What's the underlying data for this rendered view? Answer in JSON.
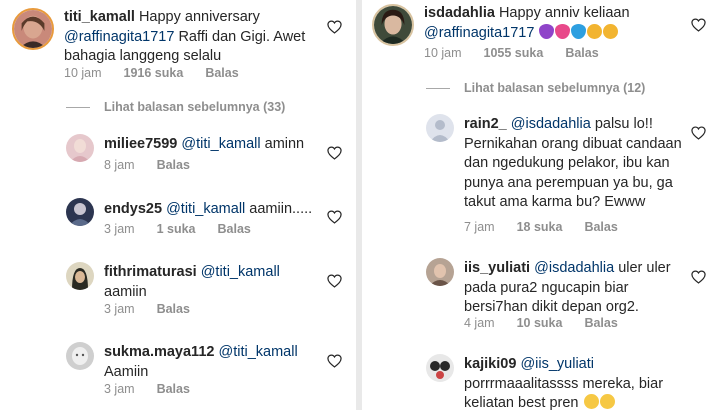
{
  "left": {
    "top_comment": {
      "username": "titi_kamall",
      "text_1": "Happy anniversary",
      "mention": "@raffinagita1717",
      "text_2": "Raffi dan Gigi. Awet bahagia langgeng selalu",
      "time": "10 jam",
      "likes": "1916 suka",
      "reply": "Balas"
    },
    "view_replies": "Lihat balasan sebelumnya (33)",
    "replies": [
      {
        "username": "miliee7599",
        "mention": "@titi_kamall",
        "text": "aminn",
        "time": "8 jam",
        "likes": "",
        "reply": "Balas"
      },
      {
        "username": "endys25",
        "mention": "@titi_kamall",
        "text": "aamiin.....",
        "time": "3 jam",
        "likes": "1 suka",
        "reply": "Balas"
      },
      {
        "username": "fithrimaturasi",
        "mention": "@titi_kamall",
        "text": "aamiin",
        "time": "3 jam",
        "likes": "",
        "reply": "Balas"
      },
      {
        "username": "sukma.maya112",
        "mention": "@titi_kamall",
        "text": "Aamiin",
        "time": "3 jam",
        "likes": "",
        "reply": "Balas"
      }
    ]
  },
  "right": {
    "top_comment": {
      "username": "isdadahlia",
      "text_1": "Happy anniv keliaan",
      "mention": "@raffinagita1717",
      "emojis": [
        "purple-heart",
        "pink-heart",
        "blue-heart",
        "folded-hands",
        "folded-hands"
      ],
      "time": "10 jam",
      "likes": "1055 suka",
      "reply": "Balas"
    },
    "view_replies": "Lihat balasan sebelumnya (12)",
    "replies": [
      {
        "username": "rain2_",
        "mention": "@isdadahlia",
        "text": "palsu lo!! Pernikahan orang dibuat candaan dan ngedukung pelakor, ibu kan punya ana perempuan ya bu, ga takut ama karma bu? Ewww",
        "time": "7 jam",
        "likes": "18 suka",
        "reply": "Balas"
      },
      {
        "username": "iis_yuliati",
        "mention": "@isdadahlia",
        "text": "uler uler pada pura2 ngucapin biar bersi7han dikit depan org2.",
        "time": "4 jam",
        "likes": "10 suka",
        "reply": "Balas"
      },
      {
        "username": "kajiki09",
        "mention": "@iis_yuliati",
        "text": "porrrmaaalitassss mereka, biar keliatan best pren",
        "emojis": [
          "grinning-sweat",
          "grinning-sweat"
        ]
      }
    ]
  },
  "colors": {
    "purple-heart": "#8f44c9",
    "pink-heart": "#e8498a",
    "blue-heart": "#2d9fe0",
    "folded-hands": "#f2b430",
    "grinning-sweat": "#f6c844"
  }
}
